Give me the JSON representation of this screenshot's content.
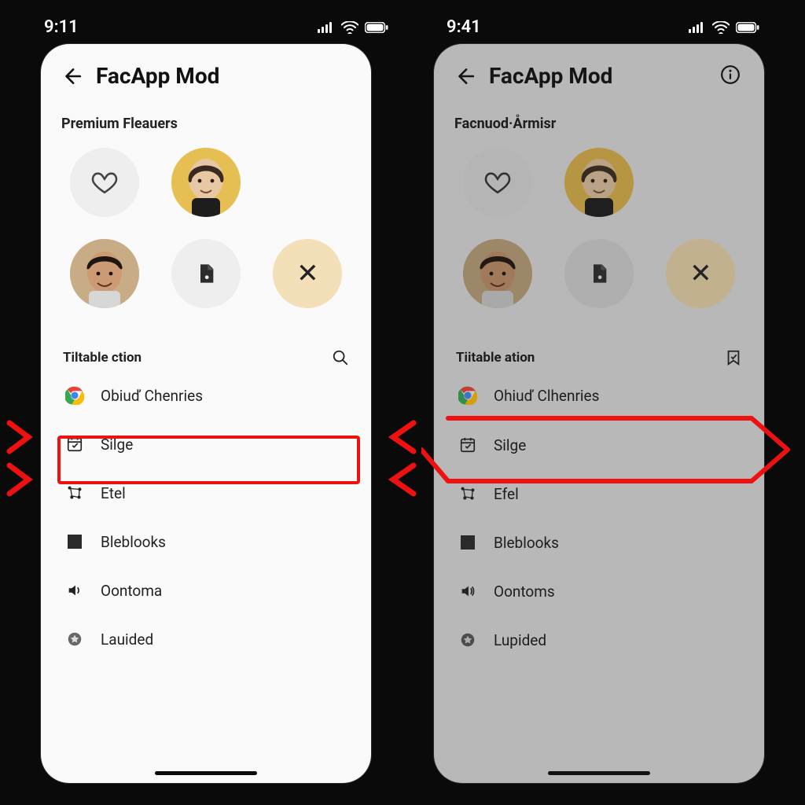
{
  "left": {
    "status_time": "9:11",
    "header_title": "FacApp Mod",
    "section_title": "Premium Fleauers",
    "list_header": "Tiltable ction",
    "items": [
      "Obiuď Chenries",
      "Silge",
      "Etel",
      "Bleblooks",
      "Oontoma",
      "Lauided"
    ]
  },
  "right": {
    "status_time": "9:41",
    "header_title": "FacApp Mod",
    "section_title": "Facnuod·Årmisr",
    "list_header": "Tiitable ation",
    "items": [
      "Ohiuď Clhenries",
      "Silge",
      "Efel",
      "Bleblooks",
      "Oontoms",
      "Lupided"
    ]
  },
  "glyphs": {
    "close_x": "✕"
  }
}
